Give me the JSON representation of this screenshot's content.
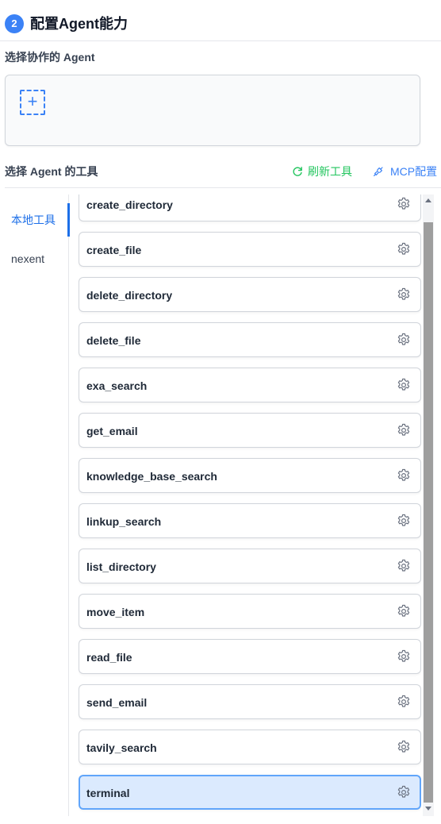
{
  "header": {
    "step_number": "2",
    "title": "配置Agent能力"
  },
  "collaborator": {
    "label": "选择协作的 Agent",
    "add_icon": "plus-icon",
    "add_glyph": "+"
  },
  "tools_section": {
    "label": "选择 Agent 的工具",
    "refresh_label": "刷新工具",
    "refresh_icon": "refresh-icon",
    "refresh_color": "#22c55e",
    "mcp_label": "MCP配置",
    "mcp_icon": "plug-icon",
    "accent_color": "#3b82f6"
  },
  "categories": [
    {
      "label": "本地工具",
      "active": true
    },
    {
      "label": "nexent",
      "active": false
    }
  ],
  "tools": [
    {
      "name": "create_directory",
      "selected": false
    },
    {
      "name": "create_file",
      "selected": false
    },
    {
      "name": "delete_directory",
      "selected": false
    },
    {
      "name": "delete_file",
      "selected": false
    },
    {
      "name": "exa_search",
      "selected": false
    },
    {
      "name": "get_email",
      "selected": false
    },
    {
      "name": "knowledge_base_search",
      "selected": false
    },
    {
      "name": "linkup_search",
      "selected": false
    },
    {
      "name": "list_directory",
      "selected": false
    },
    {
      "name": "move_item",
      "selected": false
    },
    {
      "name": "read_file",
      "selected": false
    },
    {
      "name": "send_email",
      "selected": false
    },
    {
      "name": "tavily_search",
      "selected": false
    },
    {
      "name": "terminal",
      "selected": true
    }
  ],
  "tool_icon": "gear-icon"
}
